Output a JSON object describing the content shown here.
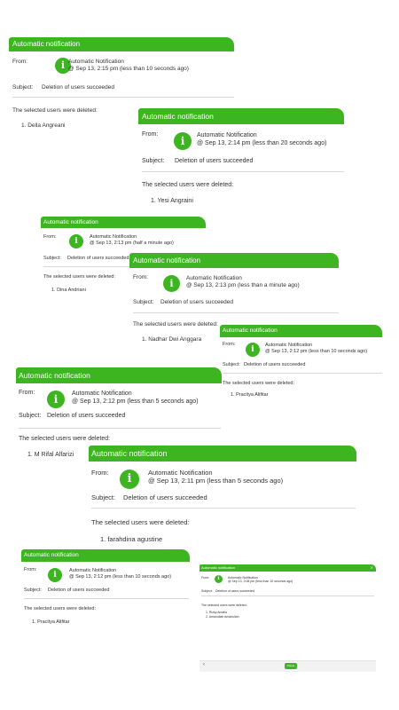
{
  "accent": "#3cb521",
  "icon_name": "info-icon",
  "labels": {
    "header": "Automatic notification",
    "from": "From:",
    "subject": "Subject:",
    "sender": "Automatic Notification",
    "subject_text": "Deletion of users succeeded",
    "body": "The selected users were deleted:",
    "icon_glyph": "i"
  },
  "notifications": [
    {
      "time": "@ Sep 13, 2:15 pm (less than 10 seconds ago)",
      "users": [
        "1. Della Angreani"
      ]
    },
    {
      "time": "@ Sep 13, 2:14 pm (less than 20 seconds ago)",
      "users": [
        "1. Yesi Angraini"
      ]
    },
    {
      "time": "@ Sep 13, 2:13 pm (half a minute ago)",
      "users": [
        "1. Dina Andriani"
      ]
    },
    {
      "time": "@ Sep 13, 2:13 pm (less than a minute ago)",
      "users": [
        "1. Nadhar Dwi Anggara"
      ]
    },
    {
      "time": "@ Sep 13, 2:12 pm (less than 10 seconds ago)",
      "users": [
        "1. Pracitya Alifitar"
      ]
    },
    {
      "time": "@ Sep 13, 2:12 pm (less than 5 seconds ago)",
      "users": [
        "1. M Rifal Alfarizi"
      ]
    },
    {
      "time": "@ Sep 13, 2:11 pm (less than 5 seconds ago)",
      "users": [
        "1. farahdina agustine"
      ]
    },
    {
      "time": "@ Sep 13, 2:12 pm (less than 10 seconds ago)",
      "users": [
        "1. Pracitya Alifitar"
      ]
    },
    {
      "time": "@ Sep 13, 2:08 pm (less than 10 seconds ago)",
      "users": [
        "1. Rizky Amalia",
        "2. Amanullah Amanullah"
      ]
    }
  ],
  "last_window": {
    "close_glyph": "✕",
    "footer_left": "‹",
    "button_label": "Delete"
  }
}
